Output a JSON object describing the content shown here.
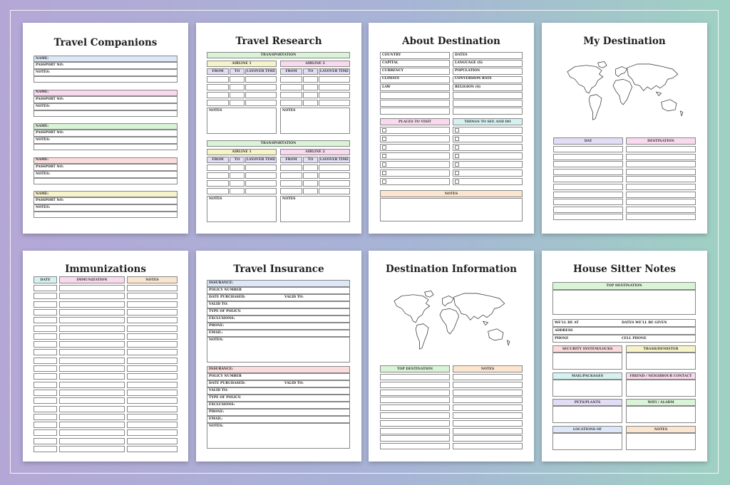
{
  "colors": {
    "blue": "#dce8f8",
    "pink": "#f9d9ee",
    "green": "#d9f3d6",
    "red": "#fbdcdc",
    "yellow": "#f7f3c9",
    "purple": "#e3dcf5",
    "cyan": "#d5f2f2",
    "peach": "#fbe5cf"
  },
  "pages": {
    "companions": {
      "title": "Travel Companions",
      "name": "NAME:",
      "passport": "PASSPORT NO:",
      "notes": "NOTES:"
    },
    "research": {
      "title": "Travel Research",
      "transportation": "TRANSPORTATION",
      "airline1": "AIRLINE 1",
      "airline2": "AIRLINE 2",
      "from": "FROM",
      "to": "TO",
      "layover": "LAYOVER TIME",
      "notes": "NOTES"
    },
    "about": {
      "title": "About Destination",
      "left_labels": [
        "COUNTRY",
        "CAPITAL",
        "CURRENCY",
        "CLIMATE",
        "LAW"
      ],
      "right_labels": [
        "DATES",
        "LANGUAGE (S)",
        "POPULATION",
        "CONVERSION RATE",
        "RELIGION (S)"
      ],
      "places": "PLACES TO VISIT",
      "things": "THINGS TO SEE AND DO",
      "notes": "NOTES"
    },
    "mydest": {
      "title": "My Destination",
      "day": "DAY",
      "destination": "DESTINATION",
      "map_icon": "world-map-icon"
    },
    "immun": {
      "title": "Immunizations",
      "date": "DATE",
      "immunization": "IMMUNIZATION",
      "notes": "NOTES"
    },
    "insurance": {
      "title": "Travel Insurance",
      "labels": [
        "INSURANCE:",
        "POLICY NUMBER",
        "DATE PURCHASED:",
        "VALID TO:",
        "TYPE OF POLICY:",
        "EXCLUSIONS:",
        "PHONE:",
        "EMAIL:",
        "NOTES:"
      ],
      "valid_to": "VALID TO:"
    },
    "destinfo": {
      "title": "Destination Information",
      "top": "TOP DESTINATION",
      "notes": "NOTES",
      "map_icon": "world-map-icon"
    },
    "house": {
      "title": "House Sitter Notes",
      "top": "TOP DESTINATION",
      "well_be_at": "WE'LL BE AT",
      "dates_given": "DATES WE'LL BE GIVEN",
      "address": "ADDRESS",
      "phone": "PHONE",
      "cell": "CELL PHONE",
      "security": "SECURITY SYSTEM/LOCKS",
      "trash": "TRASH/DEMISTER",
      "mail": "MAIL/PACKAGES",
      "friend": "FRIEND / NEIGHBOUR CONTACT",
      "pets": "PETS/PLANTS",
      "wifi": "WIFI / ALARM",
      "locations": "LOCATIONS OF",
      "notes": "NOTES"
    }
  }
}
